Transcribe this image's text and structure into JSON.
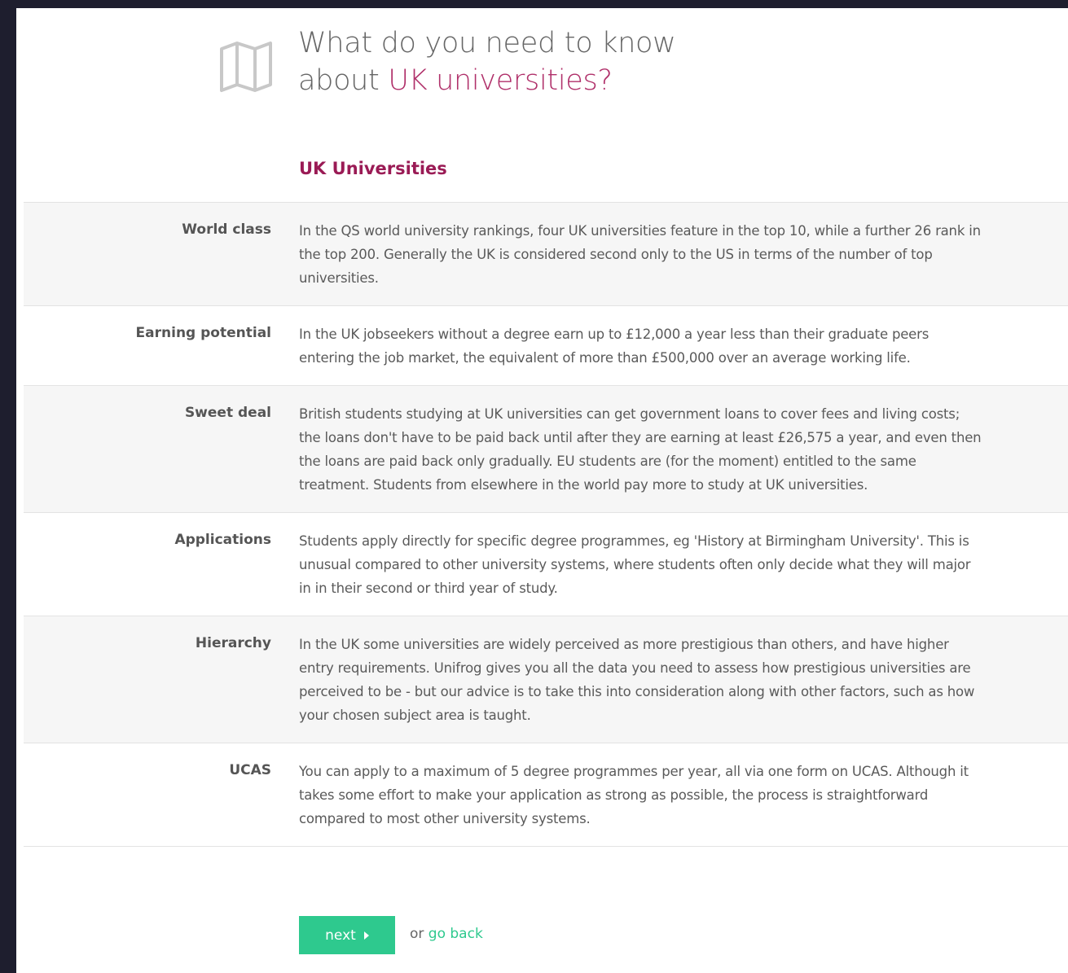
{
  "header": {
    "icon": "map-icon",
    "title_line1": "What do you need to know",
    "title_line2_prefix": "about ",
    "title_line2_accent": "UK universities?"
  },
  "section": {
    "title": "UK Universities"
  },
  "rows": [
    {
      "label": "World class",
      "text": "In the QS world university rankings, four UK universities feature in the top 10, while a further 26 rank in the top 200. Generally the UK is considered second only to the US in terms of the number of top universities."
    },
    {
      "label": "Earning potential",
      "text": "In the UK jobseekers without a degree earn up to £12,000 a year less than their graduate peers entering the job market, the equivalent of more than £500,000 over an average working life."
    },
    {
      "label": "Sweet deal",
      "text": "British students studying at UK universities can get government loans to cover fees and living costs; the loans don't have to be paid back until after they are earning at least £26,575 a year, and even then the loans are paid back only gradually. EU students are (for the moment) entitled to the same treatment. Students from elsewhere in the world pay more to study at UK universities."
    },
    {
      "label": "Applications",
      "text": "Students apply directly for specific degree programmes, eg 'History at Birmingham University'. This is unusual compared to other university systems, where students often only decide what they will major in in their second or third year of study."
    },
    {
      "label": "Hierarchy",
      "text": "In the UK some universities are widely perceived as more prestigious than others, and have higher entry requirements. Unifrog gives you all the data you need to assess how prestigious universities are perceived to be - but our advice is to take this into consideration along with other factors, such as how your chosen subject area is taught."
    },
    {
      "label": "UCAS",
      "text": "You can apply to a maximum of 5 degree programmes per year, all via one form on UCAS. Although it takes some effort to make your application as strong as possible, the process is straightforward compared to most other university systems."
    }
  ],
  "actions": {
    "next_label": "next",
    "next_icon": "caret-right-icon",
    "or_text": "or ",
    "back_label": "go back"
  },
  "colors": {
    "accent": "#b0306a",
    "section_title": "#9a1b55",
    "button": "#2ec98e",
    "row_shade": "#f6f6f6"
  }
}
